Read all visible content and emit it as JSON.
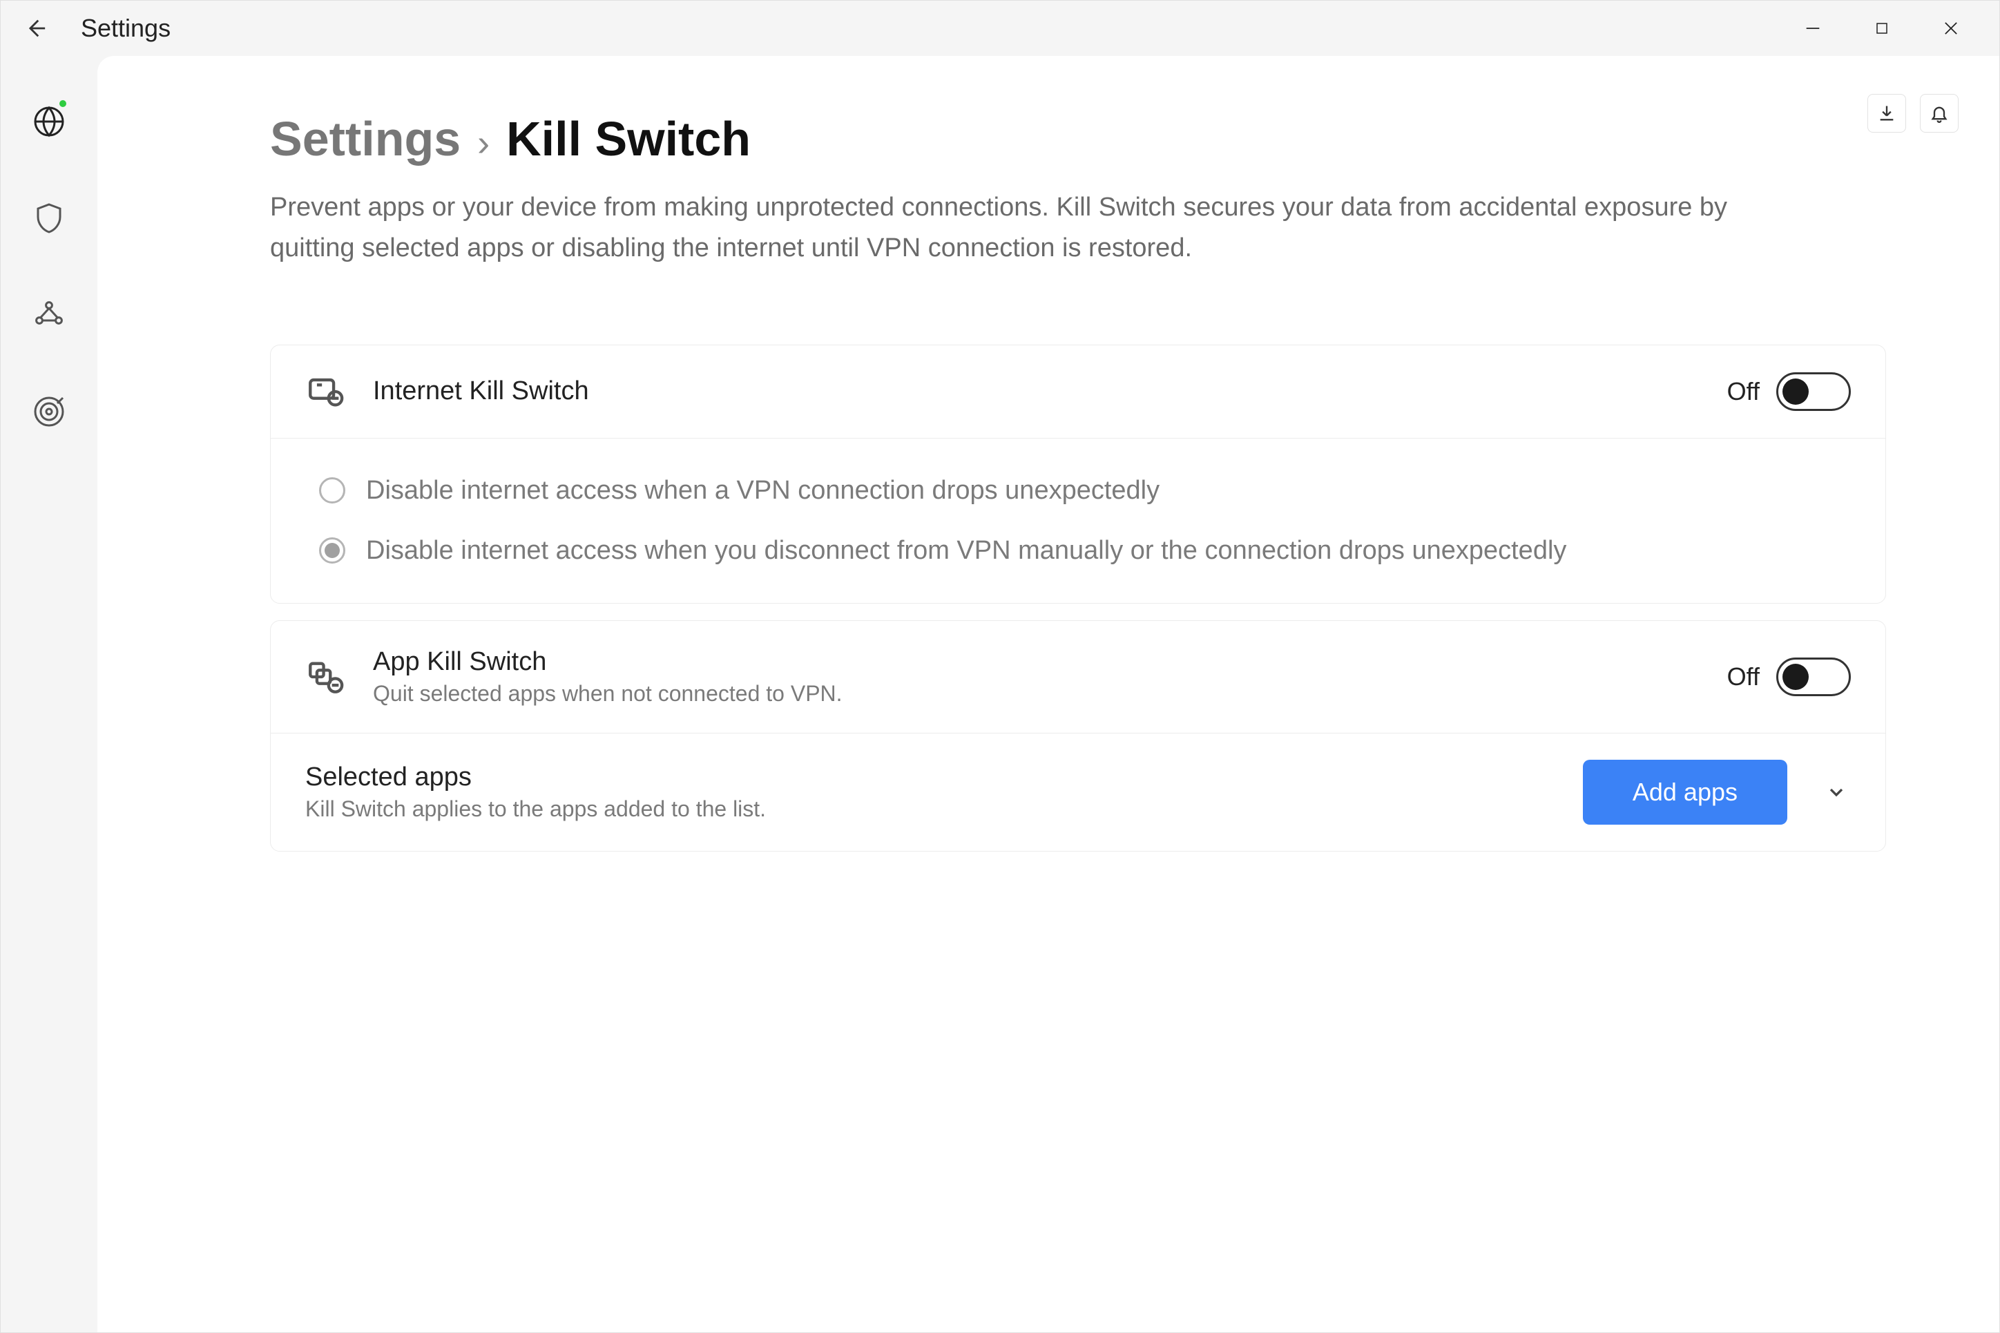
{
  "window": {
    "title": "Settings"
  },
  "breadcrumb": {
    "parent": "Settings",
    "separator": "›",
    "current": "Kill Switch"
  },
  "page_description": "Prevent apps or your device from making unprotected connections. Kill Switch secures your data from accidental exposure by quitting selected apps or disabling the internet until VPN connection is restored.",
  "internet_kill_switch": {
    "title": "Internet Kill Switch",
    "toggle_state_label": "Off",
    "options": [
      "Disable internet access when a VPN connection drops unexpectedly",
      "Disable internet access when you disconnect from VPN manually or the connection drops unexpectedly"
    ],
    "selected_option_index": 1
  },
  "app_kill_switch": {
    "title": "App Kill Switch",
    "subtitle": "Quit selected apps when not connected to VPN.",
    "toggle_state_label": "Off"
  },
  "selected_apps": {
    "title": "Selected apps",
    "subtitle": "Kill Switch applies to the apps added to the list.",
    "button_label": "Add apps"
  },
  "sidebar": {
    "items": [
      {
        "name": "connection",
        "status": "active"
      },
      {
        "name": "shield"
      },
      {
        "name": "meshnet"
      },
      {
        "name": "darkweb"
      }
    ]
  }
}
